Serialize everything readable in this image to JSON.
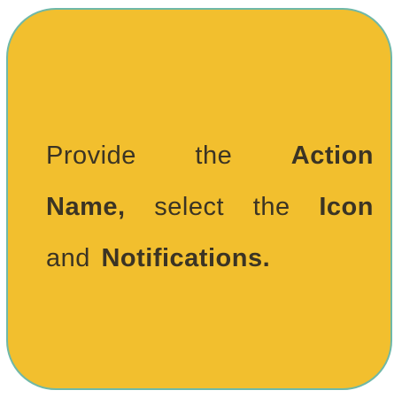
{
  "card": {
    "background_color": "#f2bf2e",
    "border_color": "#6fb8a8",
    "line1": {
      "w1": "Provide",
      "w2": "the",
      "w3": "Action"
    },
    "line2": {
      "w1": "Name,",
      "w2": "select",
      "w3": "the",
      "w4": "Icon"
    },
    "line3": {
      "w1": "and",
      "w2": "Notifications."
    }
  }
}
